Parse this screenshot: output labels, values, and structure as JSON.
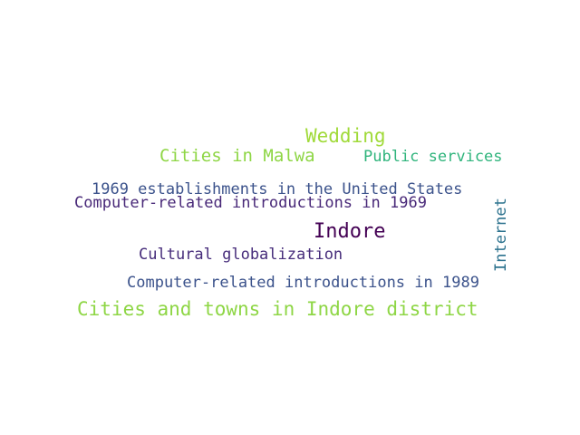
{
  "word_cloud": {
    "words": [
      {
        "text": "Wedding",
        "color": "#a0da39"
      },
      {
        "text": "Cities in Malwa",
        "color": "#8ed645"
      },
      {
        "text": "Public services",
        "color": "#2fb47c"
      },
      {
        "text": "1969 establishments in the United States",
        "color": "#3b528b"
      },
      {
        "text": "Computer-related introductions in 1969",
        "color": "#482878"
      },
      {
        "text": "Internet",
        "color": "#2c728e"
      },
      {
        "text": "Indore",
        "color": "#440154"
      },
      {
        "text": "Cultural globalization",
        "color": "#472d7b"
      },
      {
        "text": "Computer-related introductions in 1989",
        "color": "#3b528b"
      },
      {
        "text": "Cities and towns in Indore district",
        "color": "#8ed645"
      }
    ]
  }
}
